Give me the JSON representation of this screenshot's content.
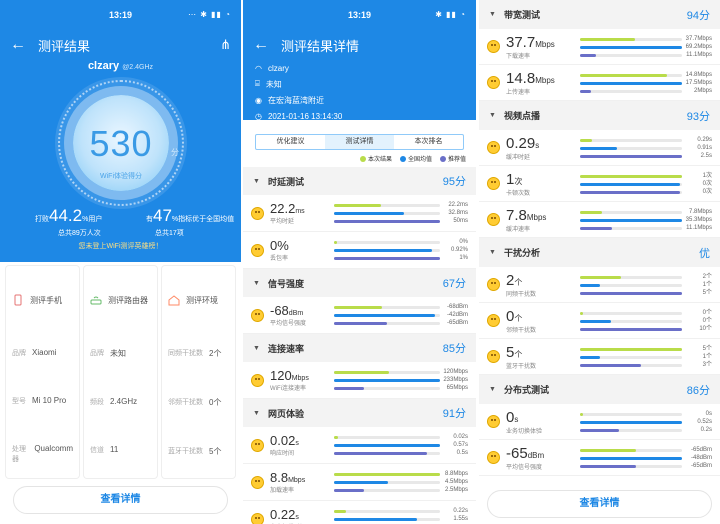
{
  "colors": {
    "green": "#b9dc4a",
    "blue": "#1e88e5",
    "purple": "#6a6fc8",
    "header": "#1e88e5"
  },
  "p1": {
    "time": "13:19",
    "title": "测评结果",
    "ssid": "clzary",
    "band": "@2.4GHz",
    "score": "530",
    "score_unit": "分",
    "score_label": "WiFi体验得分",
    "left_prefix": "打败",
    "left_value": "44.2",
    "left_suffix": "%用户",
    "left_sub": "总共89万人次",
    "right_prefix": "有",
    "right_value": "47",
    "right_suffix": "%指标优于全国均值",
    "right_sub": "总共17项",
    "tip": "您未登上WiFi测评英雄榜！",
    "cards": [
      {
        "title": "测评手机",
        "rows": [
          [
            "品牌",
            "Xiaomi"
          ],
          [
            "型号",
            "Mi 10 Pro"
          ],
          [
            "处理器",
            "Qualcomm"
          ]
        ]
      },
      {
        "title": "测评路由器",
        "rows": [
          [
            "品牌",
            "未知"
          ],
          [
            "频段",
            "2.4GHz"
          ],
          [
            "信道",
            "11"
          ]
        ]
      },
      {
        "title": "测评环境",
        "rows": [
          [
            "同频干扰数",
            "2个"
          ],
          [
            "邻频干扰数",
            "0个"
          ],
          [
            "蓝牙干扰数",
            "5个"
          ]
        ]
      }
    ],
    "button": "查看详情"
  },
  "p2": {
    "time": "13:19",
    "title": "测评结果详情",
    "ssid": "clzary",
    "router": "未知",
    "location": "在宏海蓝湾附近",
    "datetime": "2021-01-16 13:14:30",
    "tabs": [
      "优化建议",
      "测试详情",
      "本次排名"
    ],
    "legend": [
      "本次结果",
      "全国均值",
      "推荐值"
    ],
    "sections": [
      {
        "name": "时延测试",
        "score": "95分",
        "metrics": [
          {
            "v": "22.2",
            "u": "ms",
            "n": "平均时延",
            "vals": [
              "22.2ms",
              "32.8ms",
              "50ms"
            ],
            "bars": [
              0.44,
              0.66,
              1.0
            ]
          },
          {
            "v": "0%",
            "u": "",
            "n": "丢包率",
            "vals": [
              "0%",
              "0.92%",
              "1%"
            ],
            "bars": [
              0.02,
              0.92,
              1.0
            ]
          }
        ]
      },
      {
        "name": "信号强度",
        "score": "67分",
        "metrics": [
          {
            "v": "-68",
            "u": "dBm",
            "n": "平均信号强度",
            "vals": [
              "-68dBm",
              "-42dBm",
              "-65dBm"
            ],
            "bars": [
              0.45,
              0.95,
              0.5
            ]
          }
        ]
      },
      {
        "name": "连接速率",
        "score": "85分",
        "metrics": [
          {
            "v": "120",
            "u": "Mbps",
            "n": "WiFi连接速率",
            "vals": [
              "120Mbps",
              "233Mbps",
              "65Mbps"
            ],
            "bars": [
              0.52,
              1.0,
              0.28
            ]
          }
        ]
      },
      {
        "name": "网页体验",
        "score": "91分",
        "metrics": [
          {
            "v": "0.02",
            "u": "s",
            "n": "响应时间",
            "vals": [
              "0.02s",
              "0.57s",
              "0.5s"
            ],
            "bars": [
              0.04,
              1.0,
              0.88
            ]
          },
          {
            "v": "8.8",
            "u": "Mbps",
            "n": "加载速率",
            "vals": [
              "8.8Mbps",
              "4.5Mbps",
              "2.5Mbps"
            ],
            "bars": [
              1.0,
              0.51,
              0.28
            ]
          },
          {
            "v": "0.22",
            "u": "s",
            "n": "完全加载时间",
            "vals": [
              "0.22s",
              "1.55s",
              "2s"
            ],
            "bars": [
              0.11,
              0.78,
              1.0
            ]
          }
        ]
      }
    ]
  },
  "p3": {
    "sections": [
      {
        "name": "带宽测试",
        "score": "94分",
        "metrics": [
          {
            "v": "37.7",
            "u": "Mbps",
            "n": "下载速率",
            "vals": [
              "37.7Mbps",
              "69.2Mbps",
              "11.1Mbps"
            ],
            "bars": [
              0.54,
              1.0,
              0.16
            ]
          },
          {
            "v": "14.8",
            "u": "Mbps",
            "n": "上传速率",
            "vals": [
              "14.8Mbps",
              "17.5Mbps",
              "2Mbps"
            ],
            "bars": [
              0.85,
              1.0,
              0.11
            ]
          }
        ]
      },
      {
        "name": "视频点播",
        "score": "93分",
        "metrics": [
          {
            "v": "0.29",
            "u": "s",
            "n": "缓冲时延",
            "vals": [
              "0.29s",
              "0.91s",
              "2.5s"
            ],
            "bars": [
              0.12,
              0.36,
              1.0
            ]
          },
          {
            "v": "1",
            "u": "次",
            "n": "卡顿次数",
            "vals": [
              "1次",
              "0次",
              "0次"
            ],
            "bars": [
              1.0,
              0.98,
              0.98
            ]
          },
          {
            "v": "7.8",
            "u": "Mbps",
            "n": "缓冲速率",
            "vals": [
              "7.8Mbps",
              "35.3Mbps",
              "11.1Mbps"
            ],
            "bars": [
              0.22,
              1.0,
              0.31
            ]
          }
        ]
      },
      {
        "name": "干扰分析",
        "score": "优",
        "metrics": [
          {
            "v": "2",
            "u": "个",
            "n": "同频干扰数",
            "vals": [
              "2个",
              "1个",
              "5个"
            ],
            "bars": [
              0.4,
              0.2,
              1.0
            ]
          },
          {
            "v": "0",
            "u": "个",
            "n": "邻频干扰数",
            "vals": [
              "0个",
              "0个",
              "10个"
            ],
            "bars": [
              0.0,
              0.3,
              1.0
            ]
          },
          {
            "v": "5",
            "u": "个",
            "n": "蓝牙干扰数",
            "vals": [
              "5个",
              "1个",
              "3个"
            ],
            "bars": [
              1.0,
              0.2,
              0.6
            ]
          }
        ]
      },
      {
        "name": "分布式测试",
        "score": "86分",
        "metrics": [
          {
            "v": "0",
            "u": "s",
            "n": "业务切换体验",
            "vals": [
              "0s",
              "0.52s",
              "0.2s"
            ],
            "bars": [
              0.0,
              1.0,
              0.38
            ]
          },
          {
            "v": "-65",
            "u": "dBm",
            "n": "平均信号强度",
            "vals": [
              "-65dBm",
              "-48dBm",
              "-65dBm"
            ],
            "bars": [
              0.55,
              1.0,
              0.55
            ]
          }
        ]
      }
    ],
    "button": "查看详情"
  }
}
